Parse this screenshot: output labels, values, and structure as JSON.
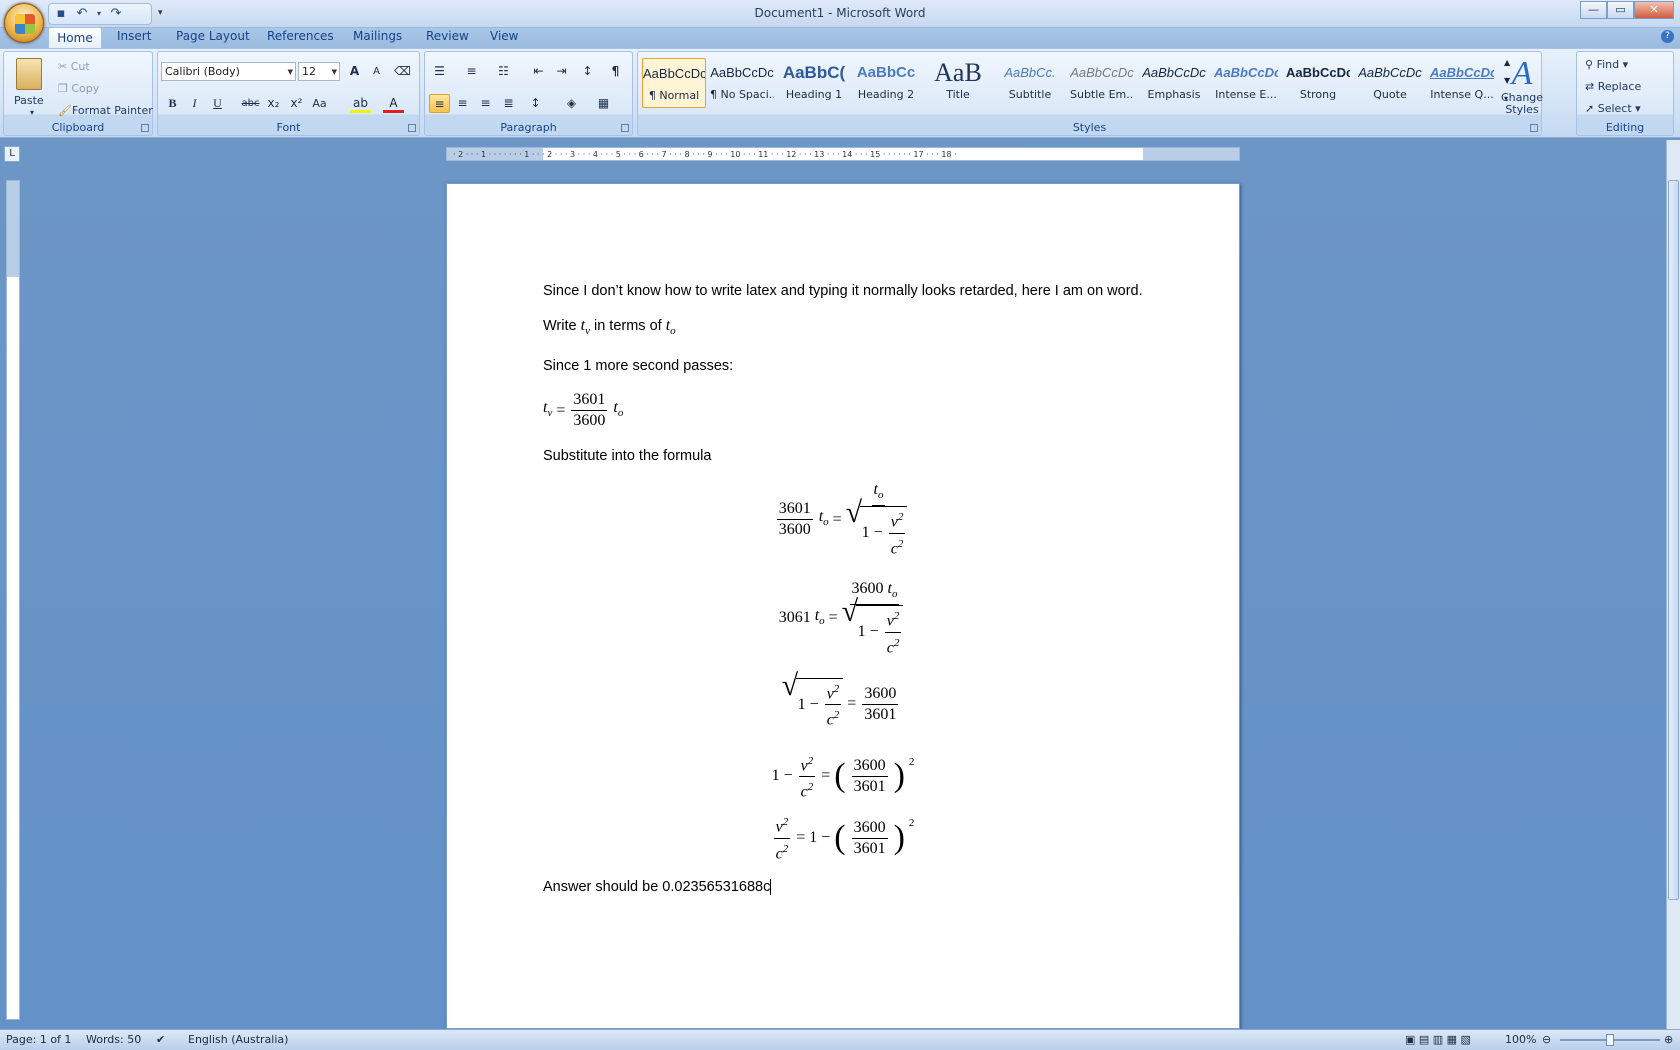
{
  "window": {
    "title": "Document1 - Microsoft Word",
    "min": "—",
    "max": "▭",
    "close": "✕"
  },
  "qat": {
    "save_icon": "save-icon",
    "undo_icon": "undo-icon",
    "redo_icon": "redo-icon",
    "customize": "▾"
  },
  "tabs": [
    "Home",
    "Insert",
    "Page Layout",
    "References",
    "Mailings",
    "Review",
    "View"
  ],
  "clipboard": {
    "label": "Clipboard",
    "paste": "Paste",
    "cut": "Cut",
    "copy": "Copy",
    "format_painter": "Format Painter"
  },
  "font": {
    "label": "Font",
    "family": "Calibri (Body)",
    "size": "12",
    "bold": "B",
    "italic": "I",
    "underline": "U",
    "strike": "abc",
    "subscript": "x₂",
    "superscript": "x²",
    "change_case": "Aa",
    "grow": "A",
    "shrink": "A"
  },
  "paragraph": {
    "label": "Paragraph",
    "pilcrow": "¶"
  },
  "styles": {
    "label": "Styles",
    "items": [
      {
        "preview": "AaBbCcDc",
        "name": "¶ Normal"
      },
      {
        "preview": "AaBbCcDc",
        "name": "¶ No Spaci..."
      },
      {
        "preview": "AaBbC(",
        "name": "Heading 1"
      },
      {
        "preview": "AaBbCc",
        "name": "Heading 2"
      },
      {
        "preview": "AaB",
        "name": "Title"
      },
      {
        "preview": "AaBbCc.",
        "name": "Subtitle"
      },
      {
        "preview": "AaBbCcDc",
        "name": "Subtle Em..."
      },
      {
        "preview": "AaBbCcDc",
        "name": "Emphasis"
      },
      {
        "preview": "AaBbCcDc",
        "name": "Intense E..."
      },
      {
        "preview": "AaBbCcDc",
        "name": "Strong"
      },
      {
        "preview": "AaBbCcDc",
        "name": "Quote"
      },
      {
        "preview": "AaBbCcDc",
        "name": "Intense Q..."
      }
    ],
    "change": "Change Styles"
  },
  "editing": {
    "label": "Editing",
    "find": "Find",
    "replace": "Replace",
    "select": "Select"
  },
  "ruler": {
    "marks": "· 2 · · · 1 · · · · · · · 1 · · · 2 · · · 3 · · · 4 · · · 5 · · · 6 · · · 7 · · · 8 · · · 9 · · · 10 · · · 11 · · · 12 · · · 13 · · · 14 · · · 15 · · · · · · 17 · · · 18 ·"
  },
  "document": {
    "p1": "Since I don’t know how to write latex and typing it normally looks retarded, here I am on word.",
    "p2_pre": "Write ",
    "p2_mid": " in terms of ",
    "p3": "Since 1 more second passes:",
    "p4": "Substitute into the formula",
    "answer": "Answer should be 0.02356531688c",
    "t": "t",
    "sub_v": "v",
    "sub_o": "o",
    "n3601": "3601",
    "n3600": "3600",
    "n3061": "3061",
    "one": "1",
    "v": "v",
    "c": "c",
    "two": "2",
    "eq": "=",
    "minus": "−"
  },
  "status": {
    "page": "Page: 1 of 1",
    "words": "Words: 50",
    "language": "English (Australia)",
    "zoom": "100%",
    "zoom_level": 1.0
  }
}
